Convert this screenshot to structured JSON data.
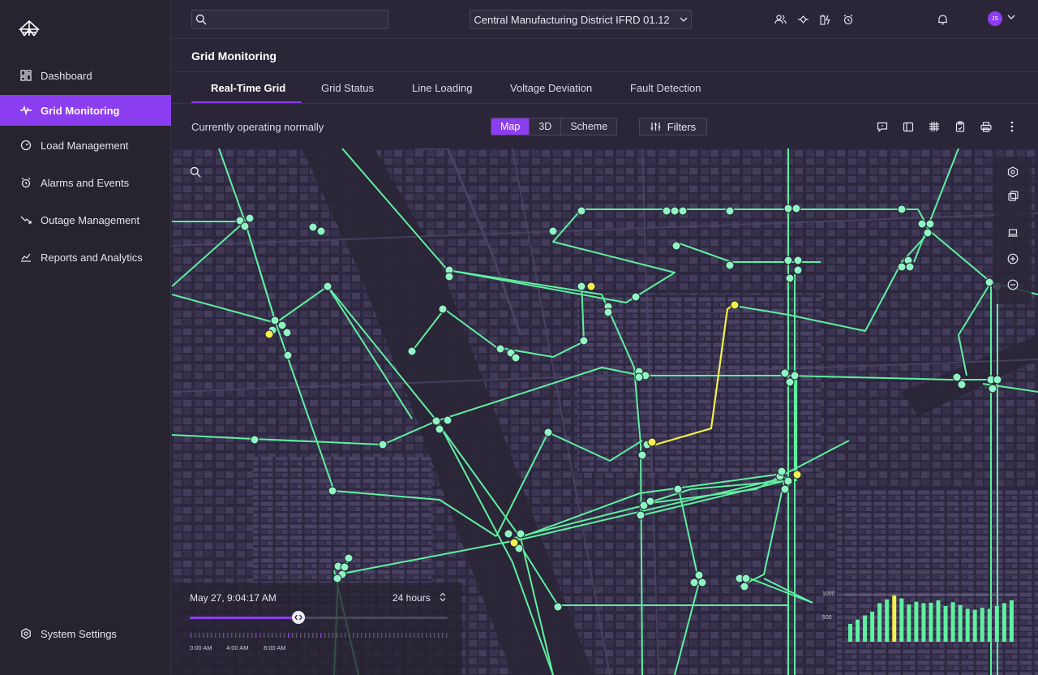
{
  "sidebar": {
    "items": [
      {
        "label": "Dashboard",
        "icon": "dashboard-icon"
      },
      {
        "label": "Grid Monitoring",
        "icon": "pulse-icon",
        "active": true
      },
      {
        "label": "Load Management",
        "icon": "gauge-icon"
      },
      {
        "label": "Alarms and Events",
        "icon": "alarm-icon"
      },
      {
        "label": "Outage Management",
        "icon": "trend-down-icon"
      },
      {
        "label": "Reports and Analytics",
        "icon": "line-chart-icon"
      }
    ],
    "settings_label": "System Settings"
  },
  "topbar": {
    "search_placeholder": "",
    "district": "Central Manufacturing District IFRD 01.12",
    "user_initials": "JS"
  },
  "page": {
    "title": "Grid Monitoring",
    "tabs": [
      "Real-Time Grid",
      "Grid Status",
      "Line Loading",
      "Voltage Deviation",
      "Fault Detection"
    ],
    "active_tab": 0,
    "status": "Currently operating normally",
    "views": [
      "Map",
      "3D",
      "Scheme"
    ],
    "active_view": 0,
    "filters_label": "Filters"
  },
  "timeline": {
    "date": "May 27, 9:04:17 AM",
    "range": "24 hours",
    "progress": 0.42,
    "tick_labels": [
      "0:00 AM",
      "4:00 AM",
      "8:00 AM"
    ]
  },
  "histogram": {
    "ymax_label": "1000",
    "ymid_label": "500",
    "values": [
      380,
      470,
      560,
      640,
      820,
      900,
      980,
      920,
      790,
      850,
      820,
      830,
      880,
      760,
      840,
      780,
      700,
      680,
      720,
      700,
      760,
      820,
      880
    ],
    "highlight_index": 6,
    "ymax": 1000
  },
  "colors": {
    "accent": "#8b3df0",
    "line": "#5ff0a0",
    "node": "#8ff5c4",
    "warning": "#f2f24a"
  }
}
